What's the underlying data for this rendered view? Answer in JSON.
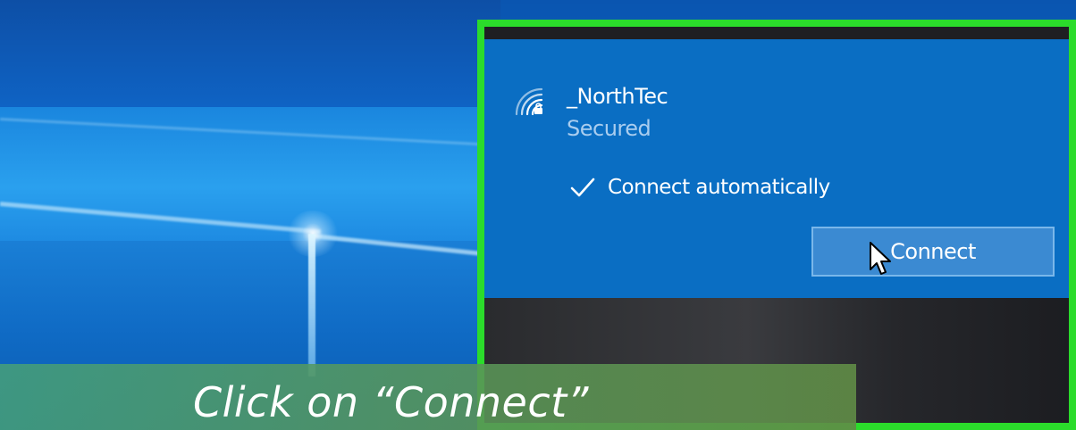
{
  "network": {
    "name": "_NorthTec",
    "status": "Secured",
    "auto_connect_label": "Connect automatically",
    "auto_connect_checked": true,
    "connect_label": "Connect",
    "icon": "wifi-icon"
  },
  "caption": {
    "text": "Click on “Connect”"
  },
  "colors": {
    "highlight_border": "#2bdc2b",
    "panel_blue": "#0a6ec3",
    "button_fill": "#3b8ad2",
    "caption_bg": "#5a9a6e"
  }
}
